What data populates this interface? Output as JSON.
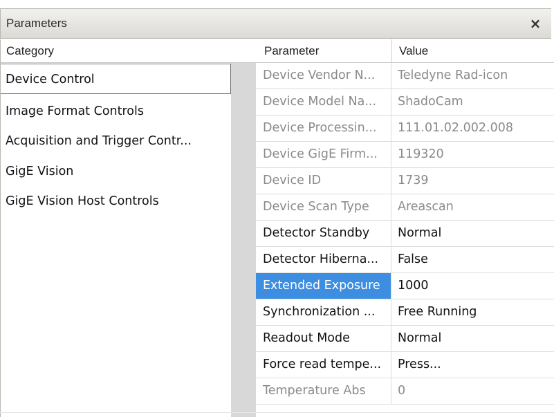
{
  "window": {
    "title": "Parameters",
    "close_label": "×"
  },
  "columns": {
    "category": "Category",
    "parameter": "Parameter",
    "value": "Value"
  },
  "categories": [
    {
      "label": "Device Control",
      "selected": true
    },
    {
      "label": "Image Format Controls",
      "selected": false
    },
    {
      "label": "Acquisition and Trigger Contr...",
      "selected": false
    },
    {
      "label": "GigE Vision",
      "selected": false
    },
    {
      "label": "GigE Vision Host Controls",
      "selected": false
    }
  ],
  "parameters": [
    {
      "name": "Device Vendor N...",
      "value": "Teledyne Rad-icon",
      "read_only": true
    },
    {
      "name": "Device Model Na...",
      "value": "ShadoCam",
      "read_only": true
    },
    {
      "name": "Device Processin...",
      "value": "111.01.02.002.008",
      "read_only": true
    },
    {
      "name": "Device GigE Firm...",
      "value": "119320",
      "read_only": true
    },
    {
      "name": "Device ID",
      "value": "1739",
      "read_only": true
    },
    {
      "name": "Device Scan Type",
      "value": "Areascan",
      "read_only": true
    },
    {
      "name": "Detector Standby",
      "value": "Normal",
      "read_only": false
    },
    {
      "name": "Detector Hiberna...",
      "value": "False",
      "read_only": false
    },
    {
      "name": "Extended Exposure",
      "value": "1000",
      "read_only": false,
      "selected": true
    },
    {
      "name": "Synchronization ...",
      "value": "Free Running",
      "read_only": false
    },
    {
      "name": "Readout Mode",
      "value": "Normal",
      "read_only": false
    },
    {
      "name": "Force read tempe...",
      "value": "Press...",
      "read_only": false
    },
    {
      "name": "Temperature Abs",
      "value": "0",
      "read_only": true
    }
  ],
  "colors": {
    "selection": "#3d8ee0",
    "read_only_text": "#8a8a8a",
    "gutter": "#d8d8d8"
  }
}
